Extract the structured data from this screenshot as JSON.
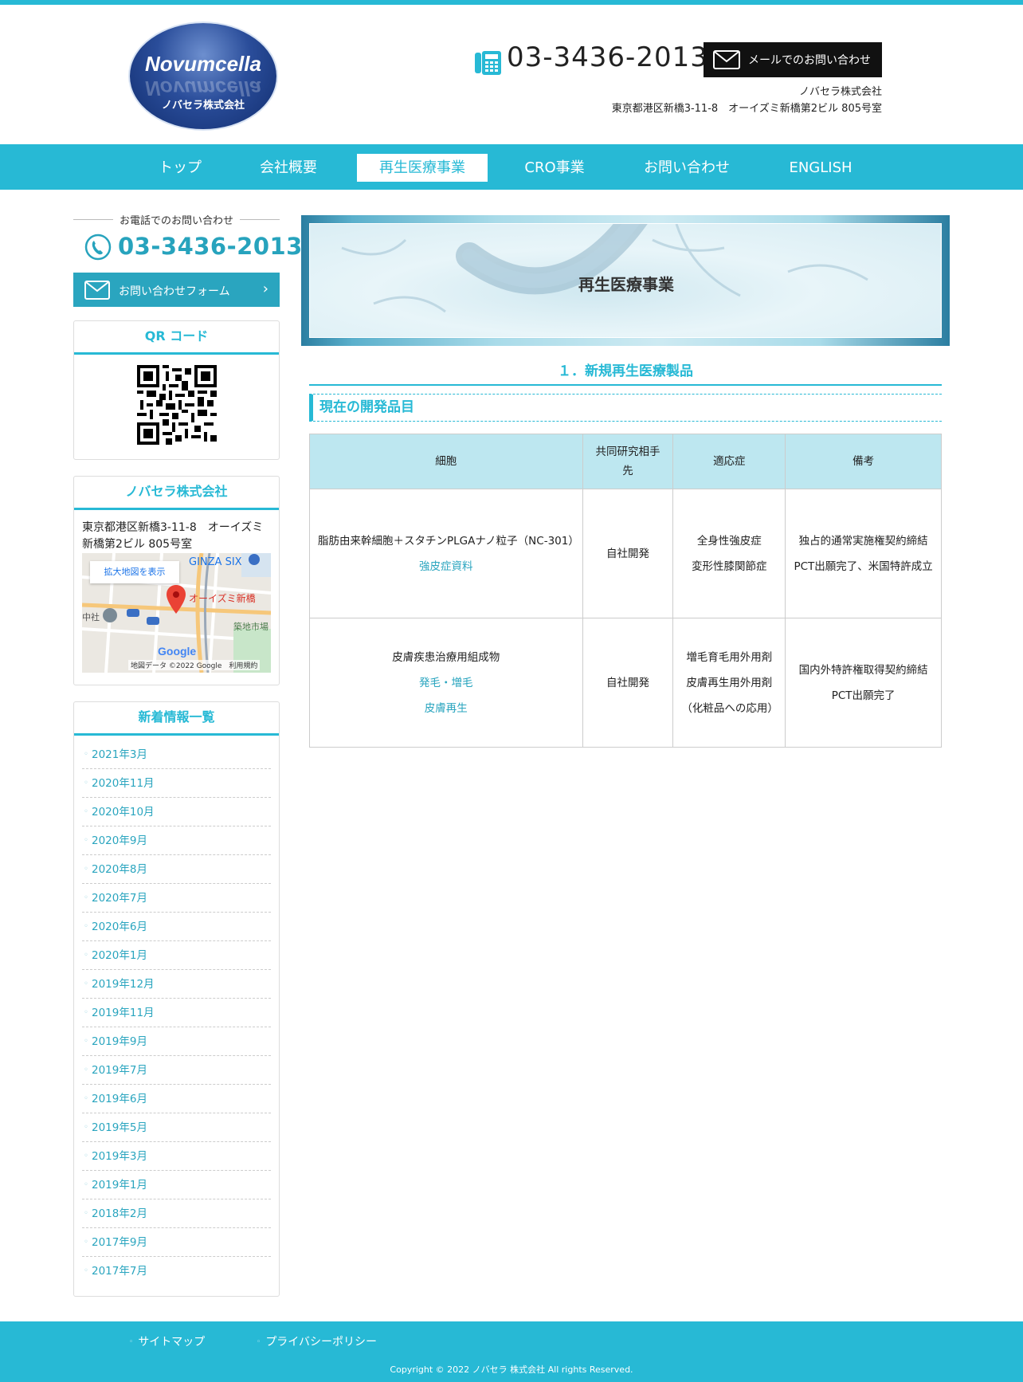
{
  "header": {
    "logo_name": "Novumcella",
    "logo_sub": "ノバセラ株式会社",
    "phone": "03-3436-2013",
    "mail_button": "メールでのお問い合わせ",
    "company": "ノバセラ株式会社",
    "address": "東京都港区新橋3-11-8　オーイズミ新橋第2ビル 805号室"
  },
  "nav": {
    "items": [
      {
        "label": "トップ",
        "active": false
      },
      {
        "label": "会社概要",
        "active": false
      },
      {
        "label": "再生医療事業",
        "active": true
      },
      {
        "label": "CRO事業",
        "active": false
      },
      {
        "label": "お問い合わせ",
        "active": false
      },
      {
        "label": "ENGLISH",
        "active": false
      }
    ]
  },
  "sidebar": {
    "contact_label": "お電話でのお問い合わせ",
    "phone": "03-3436-2013",
    "form_button": "お問い合わせフォーム",
    "qr_title": "QR コード",
    "company_title": "ノバセラ株式会社",
    "company_address": "東京都港区新橋3-11-8　オーイズミ新橋第2ビル 805号室",
    "map": {
      "enlarge": "拡大地図を表示",
      "label_ginza": "GINZA SIX",
      "label_building": "オーイズミ新橋",
      "label_market": "築地市場",
      "label_shrine": "中社",
      "google": "Google",
      "footer": "地図データ ©2022 Google　利用規約"
    },
    "news_title": "新着情報一覧",
    "news": [
      "2021年3月",
      "2020年11月",
      "2020年10月",
      "2020年9月",
      "2020年8月",
      "2020年7月",
      "2020年6月",
      "2020年1月",
      "2019年12月",
      "2019年11月",
      "2019年9月",
      "2019年7月",
      "2019年6月",
      "2019年5月",
      "2019年3月",
      "2019年1月",
      "2018年2月",
      "2017年9月",
      "2017年7月"
    ]
  },
  "main": {
    "hero_title": "再生医療事業",
    "section_title": "１．新規再生医療製品",
    "subsection_title": "現在の開発品目",
    "table": {
      "headers": [
        "細胞",
        "共同研究相手先",
        "適応症",
        "備考"
      ],
      "rows": [
        {
          "cell": "脂肪由来幹細胞＋スタチンPLGAナノ粒子（NC-301）",
          "cell_links": [
            "強皮症資料"
          ],
          "partner": "自社開発",
          "indications": [
            "全身性強皮症",
            "変形性膝関節症"
          ],
          "notes": [
            "独占的通常実施権契約締結",
            "PCT出願完了、米国特許成立"
          ]
        },
        {
          "cell": "皮膚疾患治療用組成物",
          "cell_links": [
            "発毛・増毛",
            "皮膚再生"
          ],
          "partner": "自社開発",
          "indications": [
            "増毛育毛用外用剤",
            "皮膚再生用外用剤",
            "（化粧品への応用）"
          ],
          "notes": [
            "国内外特許権取得契約締結",
            "PCT出願完了"
          ]
        }
      ]
    }
  },
  "footer": {
    "links": [
      "サイトマップ",
      "プライバシーポリシー"
    ],
    "copyright": "Copyright © 2022 ノバセラ 株式会社 All rights Reserved."
  },
  "colors": {
    "accent": "#27b9d5",
    "link": "#2aa5bf",
    "table_header": "#bde7f0"
  }
}
